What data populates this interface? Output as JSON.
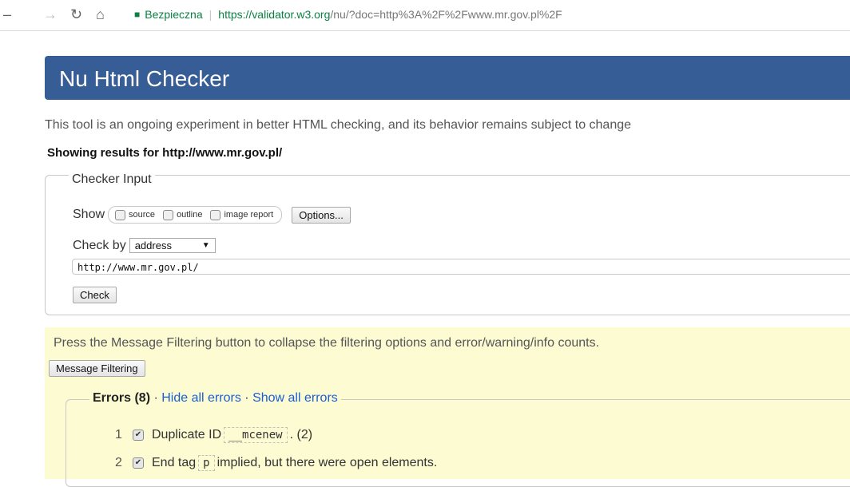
{
  "browser": {
    "secure_label": "Bezpieczna",
    "url_host": "https://validator.w3.org",
    "url_rest": "/nu/?doc=http%3A%2F%2Fwww.mr.gov.pl%2F"
  },
  "page": {
    "title": "Nu Html Checker",
    "intro": "This tool is an ongoing experiment in better HTML checking, and its behavior remains subject to change",
    "showing": "Showing results for http://www.mr.gov.pl/"
  },
  "checker_input": {
    "legend": "Checker Input",
    "show_label": "Show",
    "options": [
      "source",
      "outline",
      "image report"
    ],
    "options_button": "Options...",
    "check_by_label": "Check by",
    "check_by_value": "address",
    "address_value": "http://www.mr.gov.pl/",
    "check_button": "Check"
  },
  "filtering": {
    "text": "Press the Message Filtering button to collapse the filtering options and error/warning/info counts.",
    "button": "Message Filtering"
  },
  "errors": {
    "title": "Errors (8)",
    "dot": " · ",
    "hide_link": "Hide all errors",
    "show_link": "Show all errors",
    "items": [
      {
        "num": "1",
        "pre": "Duplicate ID",
        "code": "__mcenew",
        "post": ". (2)"
      },
      {
        "num": "2",
        "pre": "End tag",
        "code": "p",
        "post": "implied, but there were open elements."
      }
    ]
  }
}
